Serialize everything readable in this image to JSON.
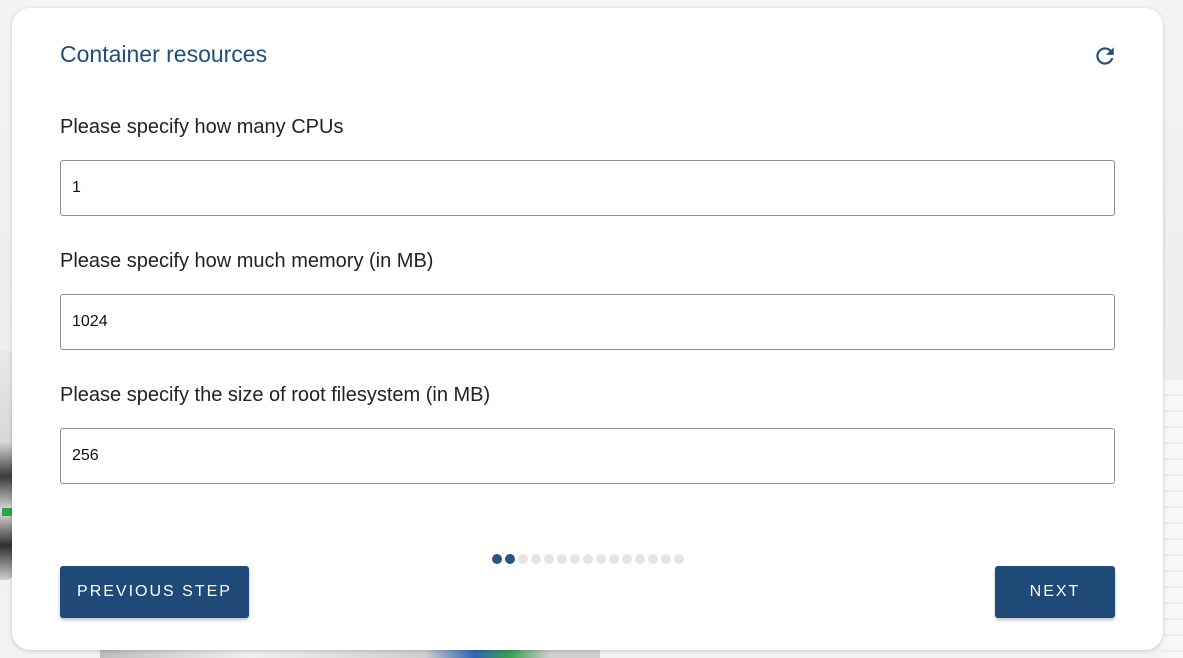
{
  "dialog": {
    "title": "Container resources",
    "refresh_icon": "refresh-icon"
  },
  "fields": {
    "cpus": {
      "label": "Please specify how many CPUs",
      "value": "1"
    },
    "memory": {
      "label": "Please specify how much memory (in MB)",
      "value": "1024"
    },
    "rootfs": {
      "label": "Please specify the size of root filesystem (in MB)",
      "value": "256"
    }
  },
  "progress": {
    "current_step": 2,
    "total_steps": 15
  },
  "buttons": {
    "previous": "PREVIOUS STEP",
    "next": "NEXT"
  },
  "colors": {
    "accent": "#1f4a78",
    "title": "#1f4e79",
    "step_done": "#2c5282",
    "step_todo": "#e4e4e4"
  }
}
